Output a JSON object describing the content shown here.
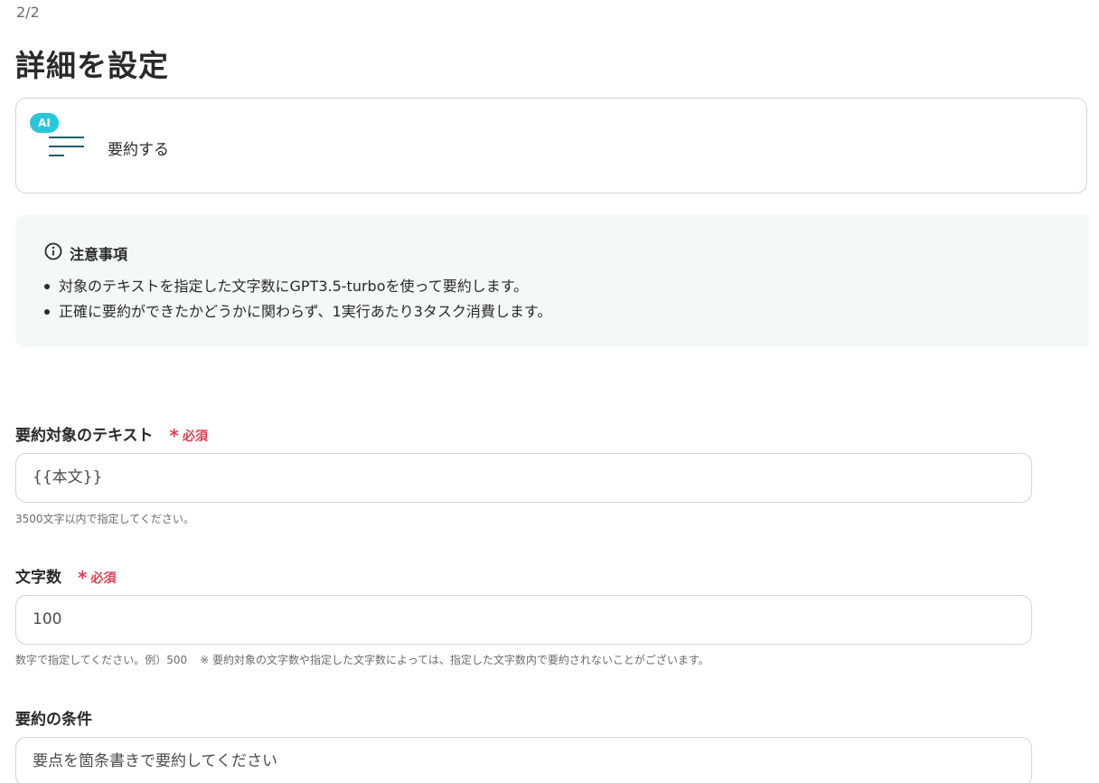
{
  "header": {
    "step": "2/2",
    "title": "詳細を設定"
  },
  "action": {
    "badge": "AI",
    "icon": "summary-lines-icon",
    "label": "要約する"
  },
  "notice": {
    "icon": "info-circle-icon",
    "title": "注意事項",
    "items": [
      "対象のテキストを指定した文字数にGPT3.5-turboを使って要約します。",
      "正確に要約ができたかどうかに関わらず、1実行あたり3タスク消費します。"
    ]
  },
  "fields": {
    "target_text": {
      "label": "要約対象のテキスト",
      "required": "必須",
      "value": "{{本文}}",
      "help": "3500文字以内で指定してください。"
    },
    "char_count": {
      "label": "文字数",
      "required": "必須",
      "value": "100",
      "help_1": "数字で指定してください。例）500",
      "help_2": "※ 要約対象の文字数や指定した文字数によっては、指定した文字数内で要約されないことがございます。"
    },
    "conditions": {
      "label": "要約の条件",
      "value": "要点を箇条書きで要約してください"
    }
  },
  "colors": {
    "accent_badge": "#27c7d9",
    "icon_teal": "#1b5e6e",
    "required": "#e03f55",
    "notice_bg": "#f3f8f8",
    "border": "#d0d4da"
  }
}
